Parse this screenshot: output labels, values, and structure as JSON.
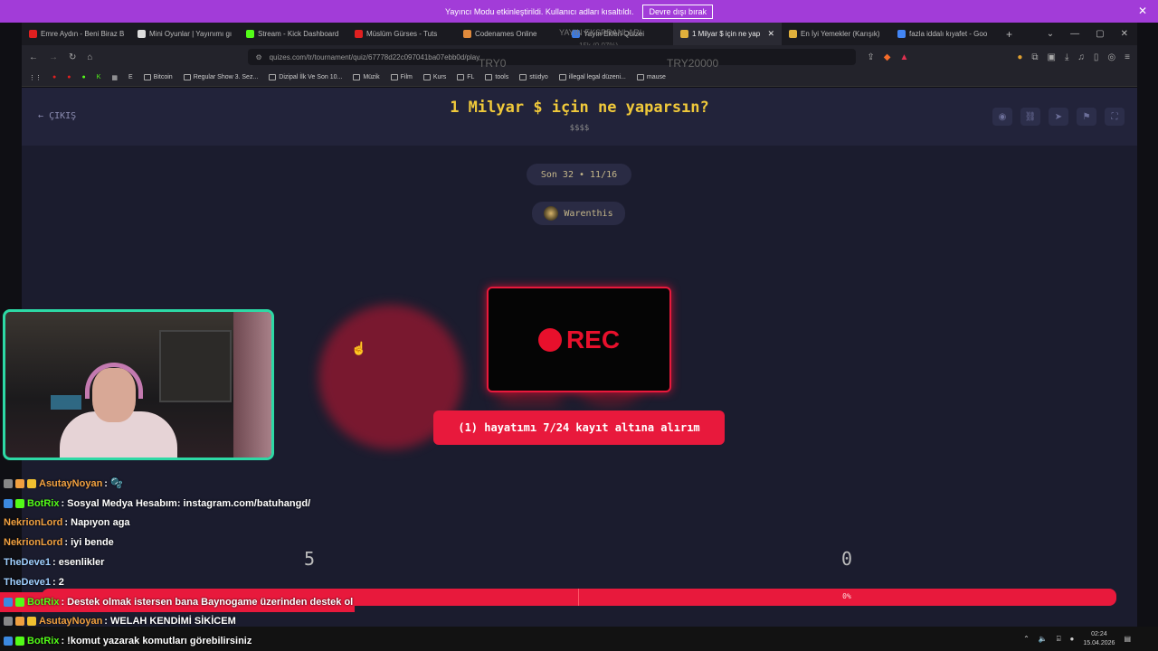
{
  "banner": {
    "message": "Yayıncı Modu etkinleştirildi. Kullanıcı adları kısaltıldı.",
    "button": "Devre dışı bırak"
  },
  "tabs": [
    {
      "title": "Emre Aydın - Beni Biraz B",
      "color": "#e02020"
    },
    {
      "title": "Mini Oyunlar | Yayınımı gı",
      "color": "#ddd"
    },
    {
      "title": "Stream - Kick Dashboard",
      "color": "#53fc18"
    },
    {
      "title": "Müslüm Gürses - Tuts",
      "color": "#e02020"
    },
    {
      "title": "Codenames Online",
      "color": "#e08a3c"
    },
    {
      "title": "Yayın Ekleri Quizei",
      "color": "#3c7ae0"
    },
    {
      "title": "1 Milyar $ için ne yap",
      "color": "#e0b03c",
      "active": true
    },
    {
      "title": "En İyi Yemekler (Karışık)",
      "color": "#e0b03c"
    },
    {
      "title": "fazla iddalı kıyafet - Goo",
      "color": "#4285f4"
    }
  ],
  "overlay": {
    "line1": "YAYIN EKSPRANLARI",
    "line2": "15k (0.07%)",
    "left": "TRY0",
    "right": "TRY20000"
  },
  "address": {
    "url": "quizes.com/tr/tournament/quiz/67778d22c097041ba07ebb0d/play"
  },
  "bookmarks": [
    "Bitcoin",
    "Regular Show 3. Sez...",
    "Dizipal İlk Ve Son 10...",
    "Müzik",
    "Film",
    "Kurs",
    "FL",
    "tools",
    "stüdyo",
    "illegal legal düzeni...",
    "mause"
  ],
  "page": {
    "exit_label": "ÇIKIŞ",
    "title": "1 Milyar $ için ne yaparsın?",
    "subtitle": "$$$$",
    "round": "Son 32 • 11/16",
    "player": "Warenthis",
    "rec_label": "REC",
    "blur_label": "EC",
    "answer": "(1) hayatımı 7/24 kayıt altına alırım",
    "score_left": "5",
    "score_right": "0",
    "progress_pct": "0%",
    "progress_value": 0
  },
  "taskbar": {
    "time": "02:24",
    "date": "15.04.2026"
  },
  "chat": [
    {
      "user": "AsutayNoyan",
      "color": "#f0a040",
      "text": ": 🫧",
      "badges": true
    },
    {
      "user": "BotRix",
      "color": "#53fc18",
      "text": ": Sosyal Medya Hesabım: instagram.com/batuhangd/",
      "bot": true
    },
    {
      "user": "NekrionLord",
      "color": "#f0a040",
      "text": ": Napıyon aga"
    },
    {
      "user": "NekrionLord",
      "color": "#f0a040",
      "text": ": iyi bende"
    },
    {
      "user": "TheDeve1",
      "color": "#a0d0ff",
      "text": ": esenlikler"
    },
    {
      "user": "TheDeve1",
      "color": "#a0d0ff",
      "text": ": 2"
    },
    {
      "user": "BotRix",
      "color": "#53fc18",
      "text": ": Destek olmak istersen bana Baynogame üzerinden destek ol",
      "bot": true,
      "highlight": true
    },
    {
      "user": "AsutayNoyan",
      "color": "#f0a040",
      "text": ": WELAH KENDİMİ SİKİCEM",
      "badges": true
    },
    {
      "user": "BotRix",
      "color": "#53fc18",
      "text": ": !komut yazarak komutları görebilirsiniz",
      "bot": true
    }
  ]
}
